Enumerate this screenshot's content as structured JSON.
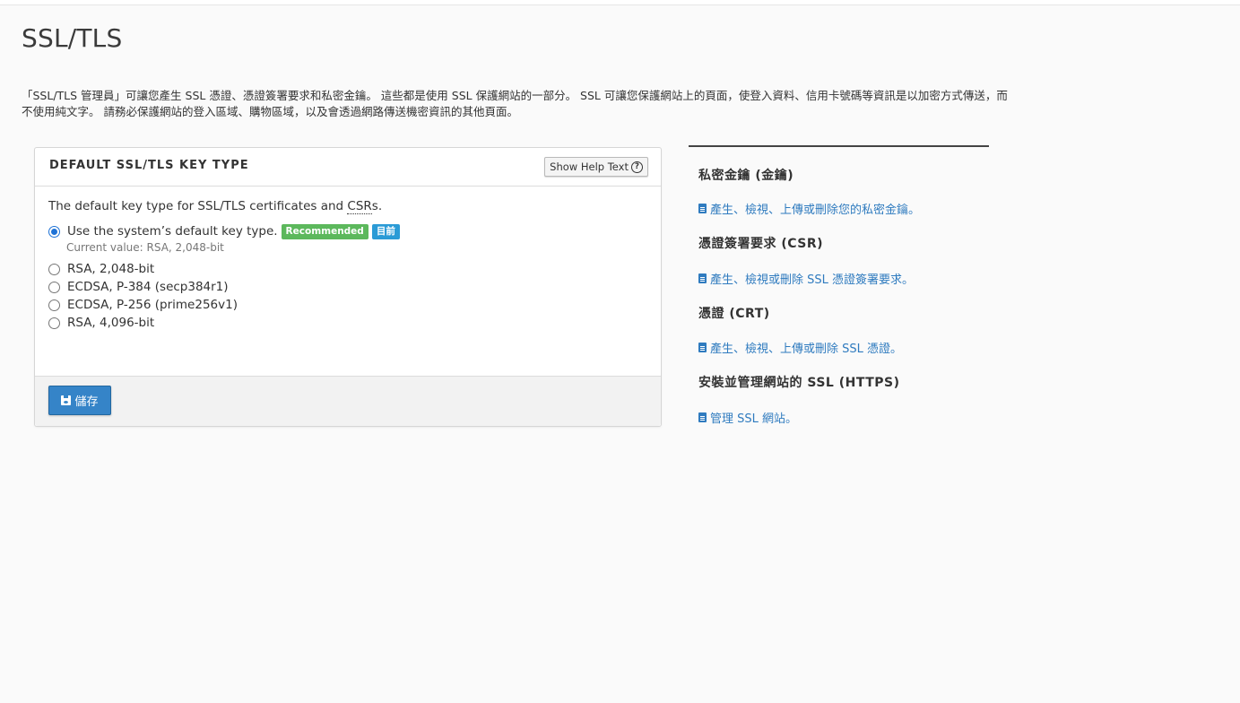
{
  "page": {
    "title": "SSL/TLS",
    "intro": "「SSL/TLS 管理員」可讓您產生 SSL 憑證、憑證簽署要求和私密金鑰。 這些都是使用 SSL 保護網站的一部分。 SSL 可讓您保護網站上的頁面，使登入資料、信用卡號碼等資訊是以加密方式傳送，而不使用純文字。 請務必保護網站的登入區域、購物區域，以及會透過網路傳送機密資訊的其他頁面。"
  },
  "panel": {
    "title": "DEFAULT SSL/TLS KEY TYPE",
    "help_button": "Show Help Text",
    "help_icon": "question-circle-icon",
    "description_prefix": "The default key type for SSL/TLS certificates and ",
    "description_abbr": "CSR",
    "description_suffix": "s.",
    "options": [
      {
        "label": "Use the system’s default key type.",
        "checked": true,
        "badges": [
          "Recommended",
          "目前"
        ],
        "current_value": "Current value: RSA, 2,048-bit"
      },
      {
        "label": "RSA, 2,048-bit",
        "checked": false
      },
      {
        "label": "ECDSA, P-384 (secp384r1)",
        "checked": false
      },
      {
        "label": "ECDSA, P-256 (prime256v1)",
        "checked": false
      },
      {
        "label": "RSA, 4,096-bit",
        "checked": false
      }
    ],
    "save_label": "儲存",
    "colors": {
      "recommended": "#5cb85c",
      "current": "#2b9bd6",
      "save": "#3584c8"
    }
  },
  "sidebar": {
    "sections": [
      {
        "heading": "私密金鑰 (金鑰)",
        "link": "產生、檢視、上傳或刪除您的私密金鑰。"
      },
      {
        "heading": "憑證簽署要求 (CSR)",
        "link": "產生、檢視或刪除 SSL 憑證簽署要求。"
      },
      {
        "heading": "憑證 (CRT)",
        "link": "產生、檢視、上傳或刪除 SSL 憑證。"
      },
      {
        "heading": "安裝並管理網站的 SSL (HTTPS)",
        "link": "管理 SSL 網站。"
      }
    ],
    "link_color": "#2f7bbf"
  }
}
